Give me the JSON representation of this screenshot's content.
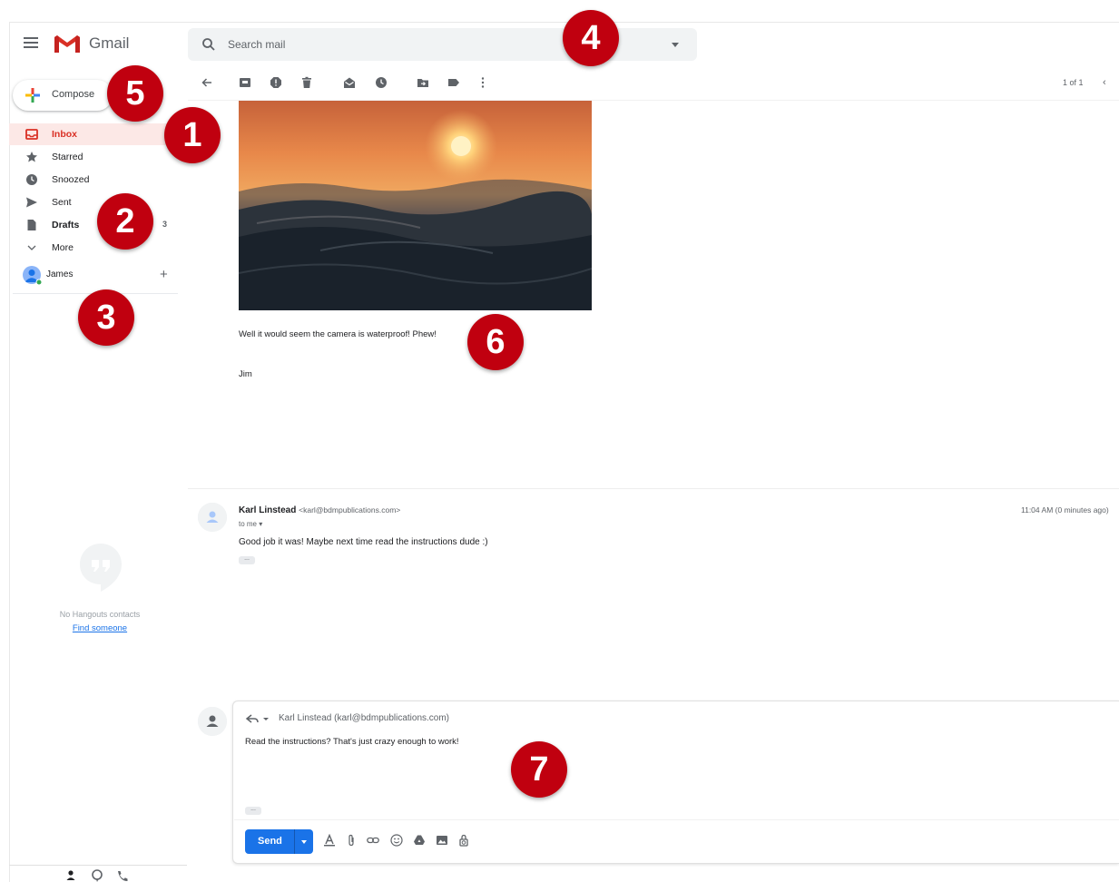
{
  "app": {
    "name": "Gmail",
    "brand_color": "#d93025"
  },
  "search": {
    "placeholder": "Search mail"
  },
  "compose": {
    "label": "Compose"
  },
  "nav": {
    "items": [
      {
        "label": "Inbox",
        "icon": "inbox-icon",
        "active": true
      },
      {
        "label": "Starred",
        "icon": "star-icon"
      },
      {
        "label": "Snoozed",
        "icon": "clock-icon"
      },
      {
        "label": "Sent",
        "icon": "send-icon"
      },
      {
        "label": "Drafts",
        "icon": "draft-icon",
        "count": "3",
        "bold": true
      },
      {
        "label": "More",
        "icon": "chevron-down-icon"
      }
    ]
  },
  "hangouts": {
    "user": "James",
    "empty_text": "No Hangouts contacts",
    "find_link": "Find someone"
  },
  "toolbar": {
    "pager": "1 of 1"
  },
  "message": {
    "body": "Well it would seem the camera is waterproof! Phew!",
    "signature": "Jim"
  },
  "reply": {
    "sender_name": "Karl Linstead",
    "sender_email": "<karl@bdmpublications.com>",
    "to": "to me",
    "time": "11:04 AM (0 minutes ago)",
    "body": "Good job it was! Maybe next time read the instructions dude :)"
  },
  "draft": {
    "to": "Karl Linstead (karl@bdmpublications.com)",
    "body": "Read the instructions? That's just crazy enough to work!",
    "send_label": "Send",
    "send_color": "#1a73e8"
  },
  "callouts": [
    "1",
    "2",
    "3",
    "4",
    "5",
    "6",
    "7"
  ],
  "callout_color": "#c0000f"
}
